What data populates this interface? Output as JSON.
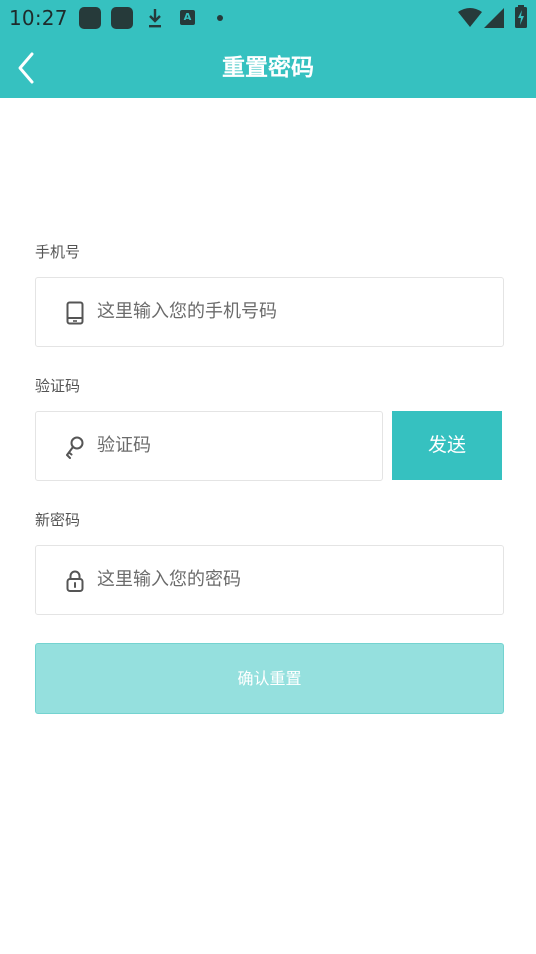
{
  "status_bar": {
    "time": "10:27",
    "icons": [
      "app-notification-icon",
      "app-notification-icon",
      "download-icon",
      "a-badge-icon",
      "dot-icon",
      "wifi-icon",
      "signal-icon",
      "battery-charging-icon"
    ],
    "a_badge": "A"
  },
  "header": {
    "title": "重置密码",
    "back_icon": "chevron-left-icon",
    "background": "#36c1c0"
  },
  "form": {
    "phone": {
      "label": "手机号",
      "placeholder": "这里输入您的手机号码",
      "icon": "tablet-icon"
    },
    "code": {
      "label": "验证码",
      "placeholder": "验证码",
      "icon": "key-icon",
      "send_label": "发送"
    },
    "password": {
      "label": "新密码",
      "placeholder": "这里输入您的密码",
      "icon": "lock-icon"
    },
    "confirm_label": "确认重置"
  },
  "colors": {
    "accent": "#36c1c0",
    "confirm_disabled": "#95e0de"
  }
}
